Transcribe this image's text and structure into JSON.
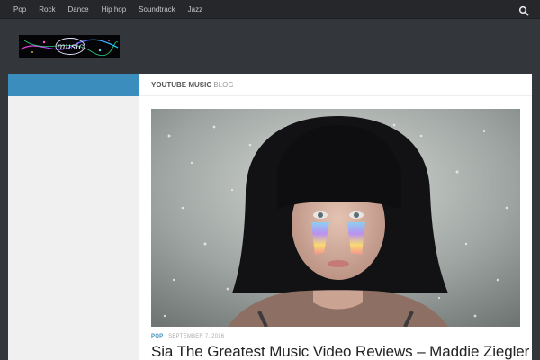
{
  "nav": {
    "items": [
      {
        "label": "Pop"
      },
      {
        "label": "Rock"
      },
      {
        "label": "Dance"
      },
      {
        "label": "Hip hop"
      },
      {
        "label": "Soundtrack"
      },
      {
        "label": "Jazz"
      }
    ],
    "search_icon": "search-icon"
  },
  "logo": {
    "text": "music"
  },
  "page_header": {
    "title_strong": "YouTube Music",
    "title_light": "Blog"
  },
  "post": {
    "category": "Pop",
    "date": "September 7, 2016",
    "title": "Sia The Greatest Music Video Reviews – Maddie Ziegler"
  },
  "colors": {
    "accent": "#3b8dbd",
    "nav_bg": "#26272b",
    "header_bg": "#33363b",
    "content_bg": "#ffffff",
    "sidebar_bg": "#f0f0f0"
  }
}
